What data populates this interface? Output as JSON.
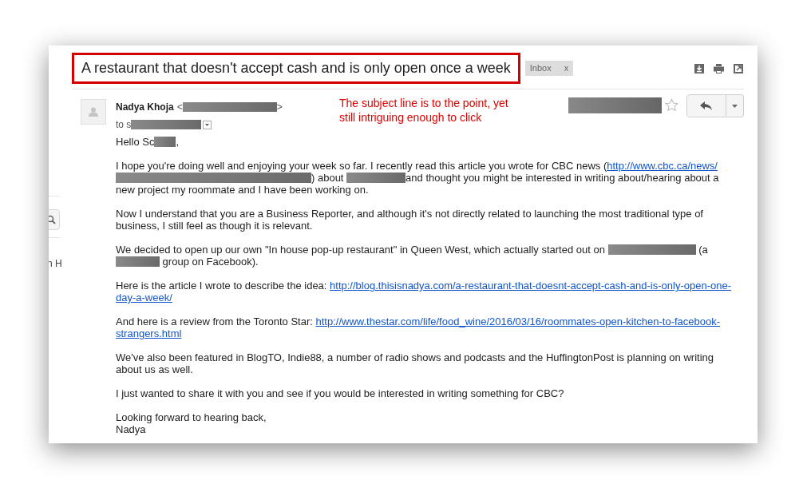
{
  "sidebar_fragment": {
    "text": "n H"
  },
  "subject": {
    "text": "A restaurant that doesn't accept cash and is only open once a week",
    "highlighted": true
  },
  "labels": [
    {
      "text": "Inbox",
      "close": "x"
    }
  ],
  "annotation": {
    "lines": [
      "The subject line is to the point, yet",
      "still intriguing enough to click"
    ]
  },
  "sender": {
    "name": "Nadya Khoja",
    "email_open": "<",
    "email_close": ">",
    "to_prefix": "to s"
  },
  "starred": false,
  "body": [
    {
      "lines": [
        [
          {
            "kind": "text",
            "text": "Hello Sc"
          },
          {
            "kind": "redacted"
          },
          {
            "kind": "text",
            "text": ","
          }
        ]
      ]
    },
    {
      "lines": [
        [
          {
            "kind": "text",
            "text": "I hope you're doing well and enjoying your week so far. I recently read this article you wrote for CBC news ("
          },
          {
            "kind": "link",
            "text": "http://www.cbc.ca/news/"
          }
        ],
        [
          {
            "kind": "redacted"
          },
          {
            "kind": "text",
            "text": ") about "
          },
          {
            "kind": "redacted"
          },
          {
            "kind": "text",
            "text": "and thought you might be interested in writing about/hearing about a"
          }
        ],
        [
          {
            "kind": "text",
            "text": "new project my roommate and I have been working on."
          }
        ]
      ]
    },
    {
      "lines": [
        [
          {
            "kind": "text",
            "text": "Now I understand that you are a Business Reporter, and although it's not directly related to launching the most traditional type of"
          }
        ],
        [
          {
            "kind": "text",
            "text": "business, I still feel as though it is relevant."
          }
        ]
      ]
    },
    {
      "lines": [
        [
          {
            "kind": "text",
            "text": "We decided to open up our own \"In house pop-up restaurant\" in Queen West, which actually started out on "
          },
          {
            "kind": "redacted"
          },
          {
            "kind": "text",
            "text": " (a"
          }
        ],
        [
          {
            "kind": "redacted"
          },
          {
            "kind": "text",
            "text": " group on Facebook)."
          }
        ]
      ]
    },
    {
      "lines": [
        [
          {
            "kind": "text",
            "text": "Here is the article I wrote to describe the idea: "
          },
          {
            "kind": "link",
            "text": "http://blog.thisisnadya.com/a-restaurant-that-doesnt-accept-cash-and-is-only-open-one-"
          }
        ],
        [
          {
            "kind": "link",
            "text": "day-a-week/"
          }
        ]
      ]
    },
    {
      "lines": [
        [
          {
            "kind": "text",
            "text": "And here is a review from the Toronto Star: "
          },
          {
            "kind": "link",
            "text": "http://www.thestar.com/life/food_wine/2016/03/16/roommates-open-kitchen-to-facebook-"
          }
        ],
        [
          {
            "kind": "link",
            "text": "strangers.html"
          }
        ]
      ]
    },
    {
      "lines": [
        [
          {
            "kind": "text",
            "text": "We've also been featured in BlogTO, Indie88, a number of radio shows and podcasts and the HuffingtonPost is planning on writing"
          }
        ],
        [
          {
            "kind": "text",
            "text": "about us as well."
          }
        ]
      ]
    },
    {
      "lines": [
        [
          {
            "kind": "text",
            "text": "I just wanted to share it with you and see if you would be interested in writing something for CBC?"
          }
        ]
      ]
    },
    {
      "lines": [
        [
          {
            "kind": "text",
            "text": "Looking forward to hearing back,"
          }
        ],
        [
          {
            "kind": "text",
            "text": "Nadya"
          }
        ]
      ]
    }
  ]
}
